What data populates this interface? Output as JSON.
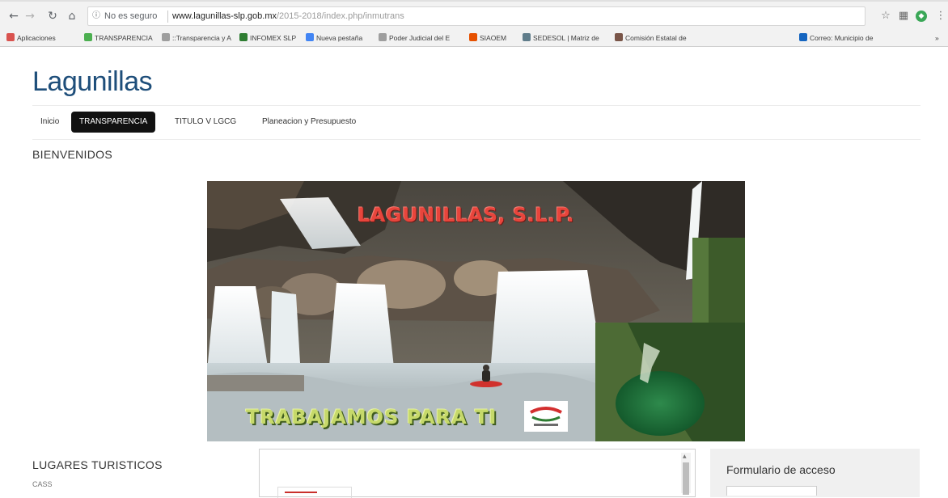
{
  "browser": {
    "security_label": "No es seguro",
    "url_host": "www.lagunillas-slp.gob.mx",
    "url_path": "/2015-2018/index.php/inmutrans",
    "bookmarks": [
      {
        "label": "Aplicaciones",
        "color": "#d9534f"
      },
      {
        "label": "TRANSPARENCIA",
        "color": "#4caf50"
      },
      {
        "label": "::Transparencia y A",
        "color": "#9e9e9e"
      },
      {
        "label": "INFOMEX SLP",
        "color": "#2e7d32"
      },
      {
        "label": "Nueva pestaña",
        "color": "#4285f4"
      },
      {
        "label": "Poder Judicial del E",
        "color": "#9e9e9e"
      },
      {
        "label": "SIAOEM",
        "color": "#e65100"
      },
      {
        "label": "SEDESOL | Matriz de",
        "color": "#607d8b"
      },
      {
        "label": "Comisión Estatal de",
        "color": "#795548"
      },
      {
        "label": "Correo: Municipio de",
        "color": "#1565c0"
      }
    ],
    "overflow_label": "»"
  },
  "site": {
    "title": "Lagunillas",
    "menu": [
      {
        "label": "Inicio",
        "active": false
      },
      {
        "label": "TRANSPARENCIA",
        "active": true
      },
      {
        "label": "TITULO V LGCG",
        "active": false
      },
      {
        "label": "Planeacion y Presupuesto",
        "active": false
      }
    ],
    "welcome": "BIENVENIDOS"
  },
  "banner": {
    "title": "LAGUNILLAS, S.L.P.",
    "slogan": "TRABAJAMOS PARA TI"
  },
  "sidebar": {
    "heading": "LUGARES TURISTICOS",
    "first_item": "CASS"
  },
  "login": {
    "title": "Formulario de acceso"
  },
  "colors": {
    "site_title": "#1e4e7a",
    "active_menu": "#111111"
  }
}
